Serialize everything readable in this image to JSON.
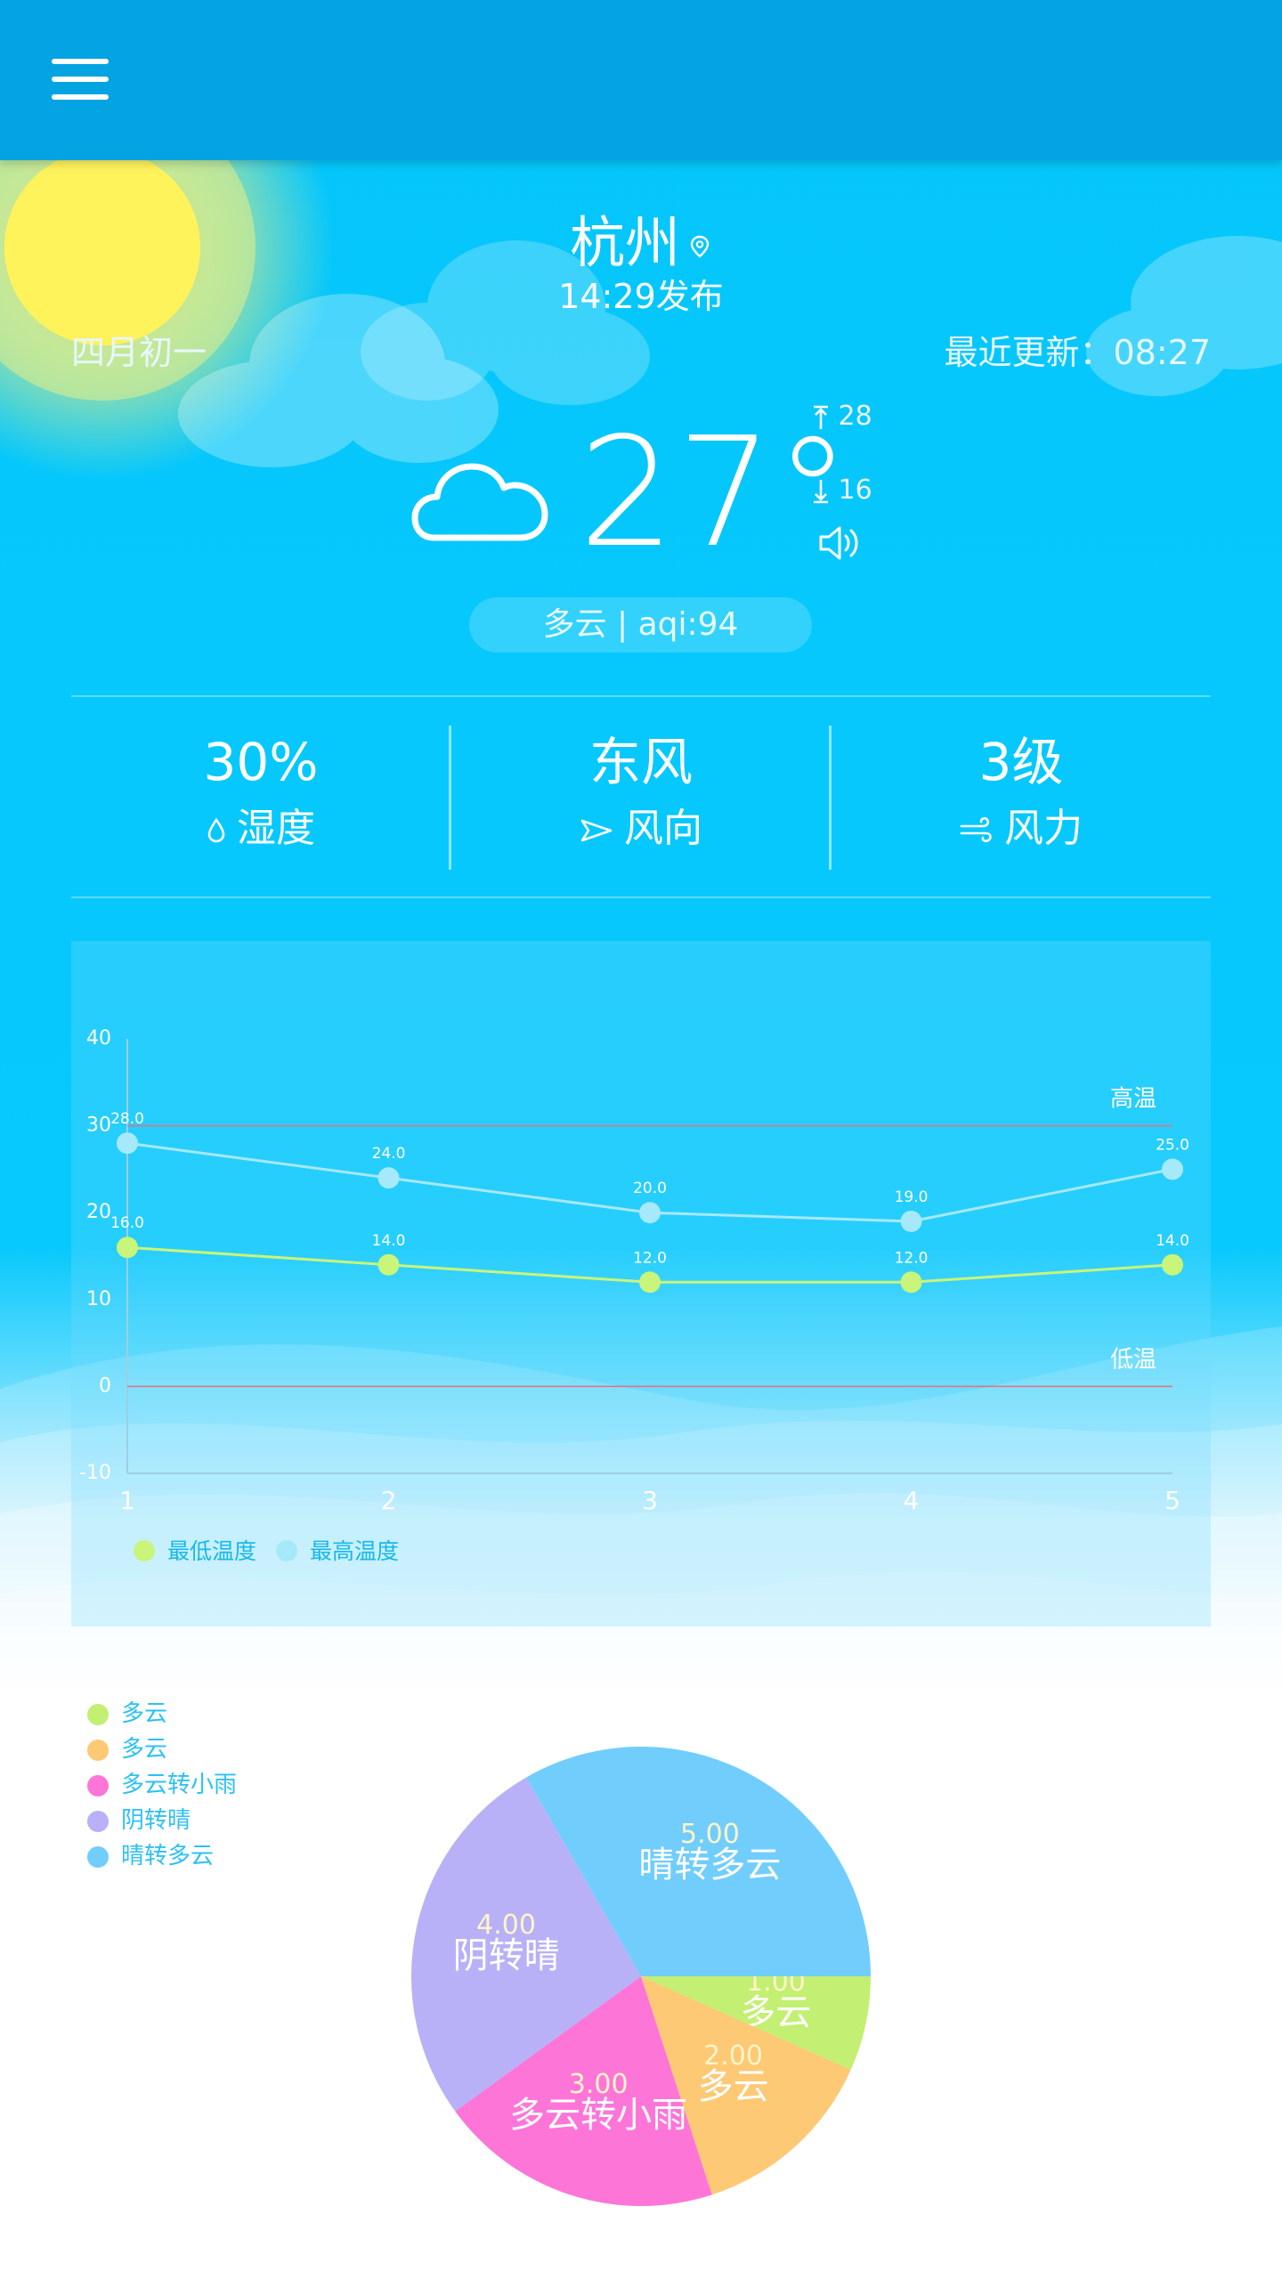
{
  "header": {
    "menu_icon": "hamburger-menu-icon"
  },
  "location": {
    "city": "杭州",
    "published": "14:29发布",
    "lunar_date": "四月初一",
    "last_updated": "最近更新：08:27"
  },
  "current": {
    "temperature": "27°",
    "high": "28",
    "low": "16",
    "condition_aqi": "多云 | aqi:94",
    "weather_icon": "cloud-icon"
  },
  "stats": [
    {
      "value": "30%",
      "label": "湿度",
      "icon": "droplet-icon"
    },
    {
      "value": "东风",
      "label": "风向",
      "icon": "direction-arrow-icon"
    },
    {
      "value": "3级",
      "label": "风力",
      "icon": "wind-icon"
    }
  ],
  "chart_data": {
    "type": "line",
    "x": [
      1,
      2,
      3,
      4,
      5
    ],
    "ylim": [
      -10,
      40
    ],
    "yticks": [
      40,
      30,
      20,
      10,
      0,
      -10
    ],
    "series": [
      {
        "name": "最低温度",
        "color": "#c8f57a",
        "values": [
          16.0,
          14.0,
          12.0,
          12.0,
          14.0
        ]
      },
      {
        "name": "最高温度",
        "color": "#a6e9fb",
        "values": [
          28.0,
          24.0,
          20.0,
          19.0,
          25.0
        ]
      }
    ],
    "limit_lines": [
      {
        "label": "高温",
        "value": 30,
        "color": "#f06b7d"
      },
      {
        "label": "低温",
        "value": 0,
        "color": "#f06b7d"
      }
    ],
    "grid": false,
    "legend_position": "bottom-left"
  },
  "pie_chart": {
    "type": "pie",
    "slices": [
      {
        "label": "多云",
        "value": 1.0,
        "value_text": "1.00",
        "color": "#c3ef72"
      },
      {
        "label": "多云",
        "value": 2.0,
        "value_text": "2.00",
        "color": "#fdc975"
      },
      {
        "label": "多云转小雨",
        "value": 3.0,
        "value_text": "3.00",
        "color": "#fe75d8"
      },
      {
        "label": "阴转晴",
        "value": 4.0,
        "value_text": "4.00",
        "color": "#b8b1f7"
      },
      {
        "label": "晴转多云",
        "value": 5.0,
        "value_text": "5.00",
        "color": "#71cdfc"
      }
    ],
    "legend_position": "top-left"
  }
}
